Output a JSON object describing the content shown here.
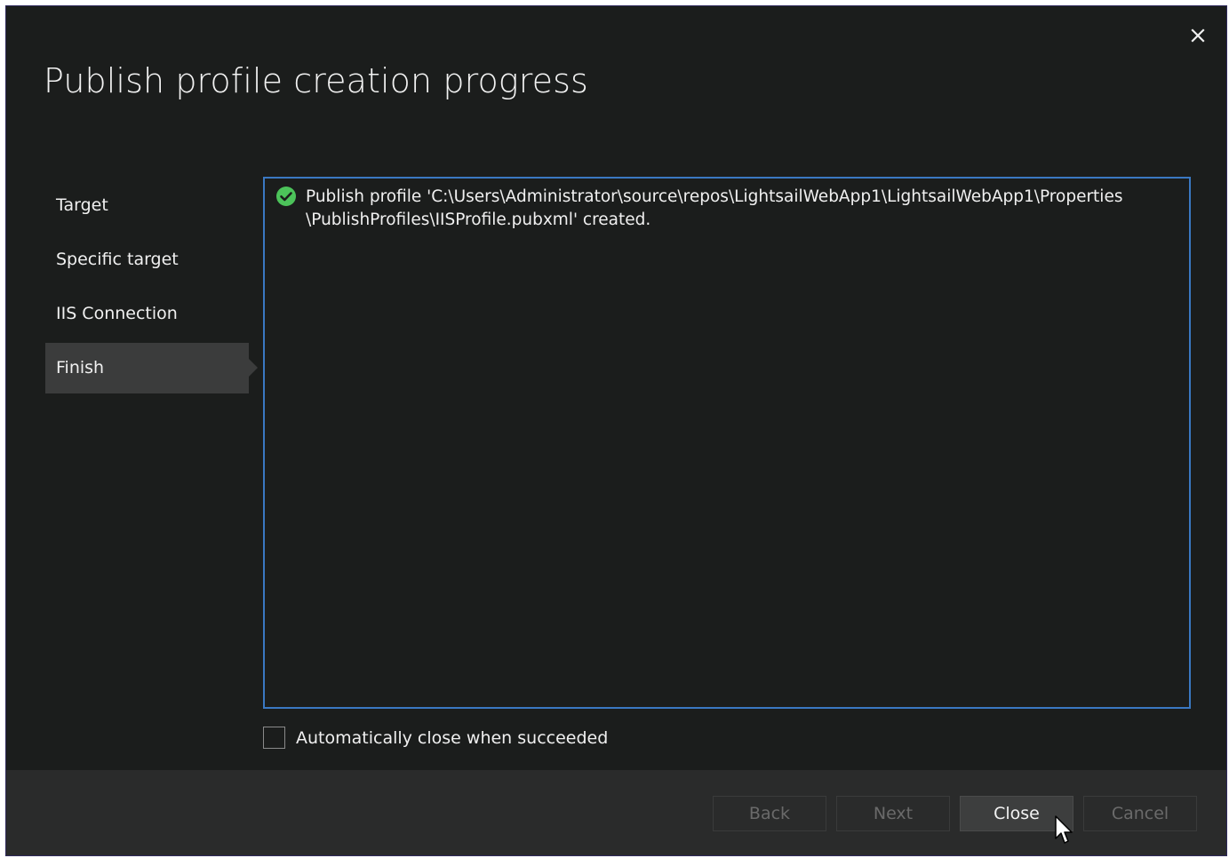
{
  "window": {
    "title": "Publish profile creation progress",
    "close_icon": "close-icon"
  },
  "steps": [
    {
      "label": "Target",
      "active": false
    },
    {
      "label": "Specific target",
      "active": false
    },
    {
      "label": "IIS Connection",
      "active": false
    },
    {
      "label": "Finish",
      "active": true
    }
  ],
  "log": {
    "entries": [
      {
        "status_icon": "success-check-icon",
        "status_color": "#4cc35a",
        "text": "Publish profile 'C:\\Users\\Administrator\\source\\repos\\LightsailWebApp1\\LightsailWebApp1\\Properties\n\\PublishProfiles\\IISProfile.pubxml' created."
      }
    ]
  },
  "options": {
    "auto_close_label": "Automatically close when succeeded",
    "auto_close_checked": false
  },
  "buttons": {
    "back": "Back",
    "next": "Next",
    "close": "Close",
    "cancel": "Cancel"
  },
  "colors": {
    "background": "#1b1d1c",
    "footer": "#2a2b2b",
    "accent_border": "#3a78c2",
    "active_step": "#3b3c3c"
  }
}
